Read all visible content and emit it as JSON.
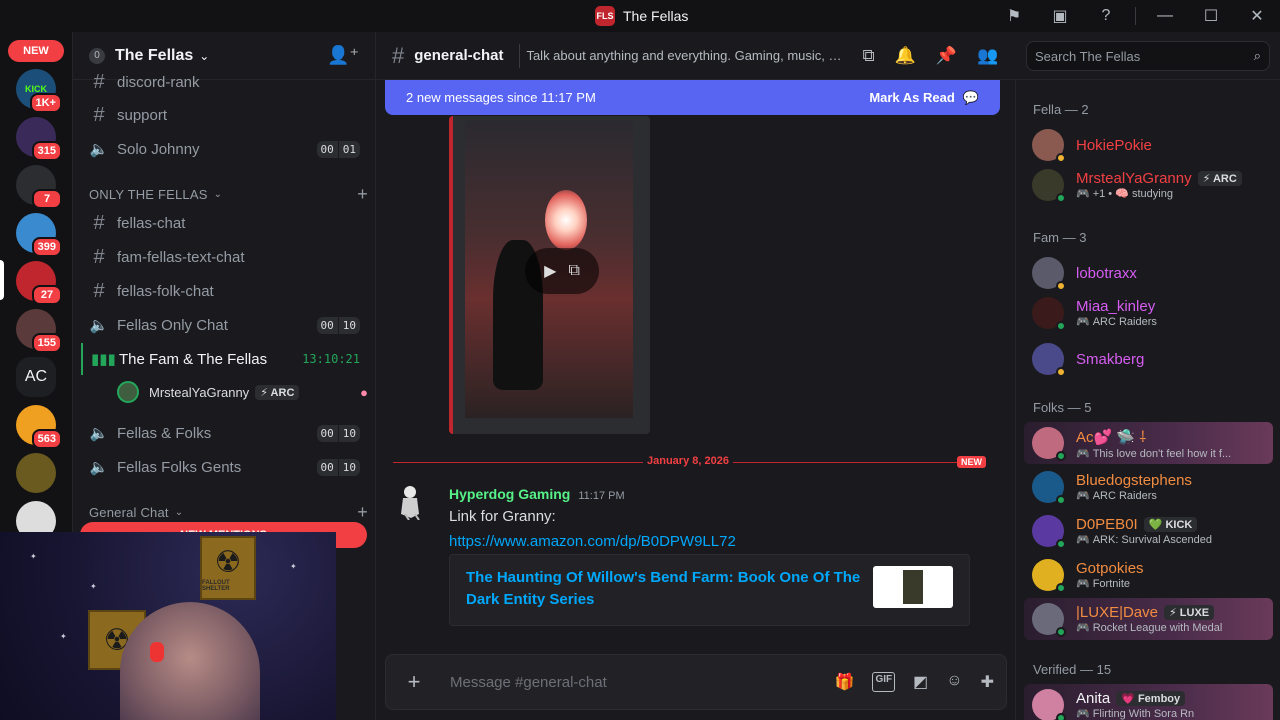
{
  "window": {
    "title": "The Fellas",
    "logo_text": "FLS"
  },
  "rail": {
    "new_label": "NEW",
    "servers": [
      {
        "label": "KICK",
        "badge": "1K+",
        "color": "#1b4f7a"
      },
      {
        "label": "",
        "badge": "315",
        "color": "#3a2a5a"
      },
      {
        "label": "",
        "badge": "7",
        "color": "#2b2d31"
      },
      {
        "label": "",
        "badge": "399",
        "color": "#3a8ad0"
      },
      {
        "label": "",
        "badge": "27",
        "color": "#c0262d"
      },
      {
        "label": "",
        "badge": "155",
        "color": "#5a3a3a"
      },
      {
        "label": "AC",
        "badge": "",
        "color": "#1e1f22"
      },
      {
        "label": "",
        "badge": "563",
        "color": "#f0a020"
      },
      {
        "label": "",
        "badge": "",
        "color": "#6a5a20"
      },
      {
        "label": "",
        "badge": "",
        "color": "#dddddd"
      }
    ]
  },
  "sidebar": {
    "server_name": "The Fellas",
    "server_shield": "0",
    "channels_top": [
      {
        "type": "text",
        "name": "discord-rank"
      },
      {
        "type": "text",
        "name": "support"
      },
      {
        "type": "voice",
        "name": "Solo Johnny",
        "count": "00",
        "limit": "01"
      }
    ],
    "category_1": "ONLY THE FELLAS",
    "channels_mid": [
      {
        "type": "text",
        "name": "fellas-chat"
      },
      {
        "type": "text",
        "name": "fam-fellas-text-chat"
      },
      {
        "type": "text",
        "name": "fellas-folk-chat"
      },
      {
        "type": "voice",
        "name": "Fellas Only Chat",
        "count": "00",
        "limit": "10"
      }
    ],
    "active_voice": {
      "name": "The Fam & The Fellas",
      "timer": "13:10:21"
    },
    "voice_member": {
      "name": "MrstealYaGranny",
      "tag": "⚡ ARC"
    },
    "channels_low": [
      {
        "type": "voice",
        "name": "Fellas & Folks",
        "count": "00",
        "limit": "10"
      },
      {
        "type": "voice",
        "name": "Fellas Folks Gents",
        "count": "00",
        "limit": "10"
      }
    ],
    "category_2": "General Chat",
    "mentions_pill": "NEW MENTIONS"
  },
  "webcam": {
    "sign_text": "FALLOUT SHELTER"
  },
  "header": {
    "channel": "general-chat",
    "topic": "Talk about anything and everything. Gaming, music, movies, life...",
    "search_placeholder": "Search The Fellas"
  },
  "newbar": {
    "text": "2 new messages since 11:17 PM",
    "mark_label": "Mark As Read"
  },
  "video": {
    "play_icon": "play-icon",
    "open_icon": "open-external-icon"
  },
  "divider": {
    "date": "January 8, 2026",
    "new_label": "NEW"
  },
  "message": {
    "author": "Hyperdog Gaming",
    "time": "11:17 PM",
    "text": "Link for Granny:",
    "link": "https://www.amazon.com/dp/B0DPW9LL72",
    "embed_title": "The Haunting Of Willow's Bend Farm: Book One Of The Dark Entity Series"
  },
  "composer": {
    "placeholder": "Message #general-chat"
  },
  "members": {
    "groups": [
      {
        "label": "Fella — 2",
        "items": [
          {
            "name": "HokiePokie",
            "color": "#f23f43",
            "activity": "",
            "tag": "",
            "av": "#8a5a50",
            "status": "#f0b232"
          },
          {
            "name": "MrstealYaGranny",
            "color": "#f23f43",
            "activity": "+1 • 🧠 studying",
            "tag": "⚡ ARC",
            "av": "#3a3a2a",
            "status": "#23a55a"
          }
        ]
      },
      {
        "label": "Fam — 3",
        "items": [
          {
            "name": "lobotraxx",
            "color": "#d65cf2",
            "activity": "",
            "tag": "",
            "av": "#5a5a6a",
            "status": "#f0b232"
          },
          {
            "name": "Miaa_kinley",
            "color": "#d65cf2",
            "activity": "ARC Raiders",
            "tag": "",
            "av": "#3a1a1a",
            "status": "#23a55a"
          },
          {
            "name": "Smakberg",
            "color": "#d65cf2",
            "activity": "",
            "tag": "",
            "av": "#4a4a8a",
            "status": "#f0b232"
          }
        ]
      },
      {
        "label": "Folks — 5",
        "items": [
          {
            "name": "Ac💕 🛸 ⸸",
            "color": "#f28c40",
            "activity": "This love don't feel how it f...",
            "tag": "",
            "av": "#c06a80",
            "status": "#23a55a",
            "banner": true
          },
          {
            "name": "Bluedogstephens",
            "color": "#f28c40",
            "activity": "ARC Raiders",
            "tag": "",
            "av": "#1a5a8a",
            "status": "#23a55a"
          },
          {
            "name": "D0PEB0I",
            "color": "#f28c40",
            "activity": "ARK: Survival Ascended",
            "tag": "💚 KICK",
            "av": "#5a3aa0",
            "status": "#23a55a"
          },
          {
            "name": "Gotpokies",
            "color": "#f28c40",
            "activity": "Fortnite",
            "tag": "",
            "av": "#e0b020",
            "status": "#23a55a"
          },
          {
            "name": "|LUXE|Dave",
            "color": "#f28c40",
            "activity": "Rocket League with Medal",
            "tag": "⚡ LUXE",
            "av": "#6a6a7a",
            "status": "#23a55a",
            "banner": true
          }
        ]
      },
      {
        "label": "Verified — 15",
        "items": [
          {
            "name": "Anita",
            "color": "#f2f3f5",
            "activity": "Flirting With Sora Rn",
            "tag": "💗 Femboy",
            "av": "#d080a0",
            "status": "#23a55a",
            "banner": true
          }
        ]
      }
    ]
  }
}
